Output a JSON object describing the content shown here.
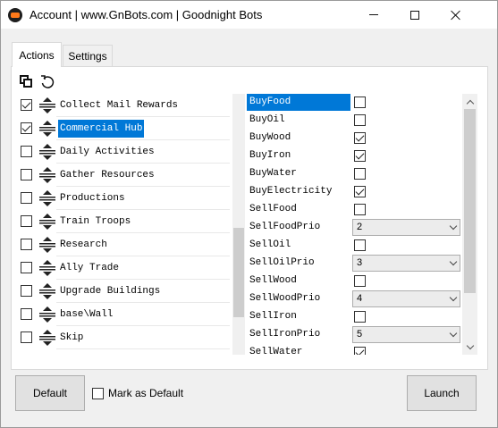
{
  "window": {
    "title": "Account | www.GnBots.com | Goodnight Bots",
    "icon": "gnbots-app-icon",
    "controls": [
      "minimize-icon",
      "maximize-icon",
      "close-icon"
    ]
  },
  "tabs": [
    {
      "label": "Actions",
      "active": true
    },
    {
      "label": "Settings",
      "active": false
    }
  ],
  "toolbar": {
    "icons": [
      "copy-icon",
      "reset-icon"
    ]
  },
  "actions": [
    {
      "label": "Collect Mail Rewards",
      "checked": true,
      "selected": false
    },
    {
      "label": "Commercial Hub",
      "checked": true,
      "selected": true
    },
    {
      "label": "Daily Activities",
      "checked": false,
      "selected": false
    },
    {
      "label": "Gather Resources",
      "checked": false,
      "selected": false
    },
    {
      "label": "Productions",
      "checked": false,
      "selected": false
    },
    {
      "label": "Train Troops",
      "checked": false,
      "selected": false
    },
    {
      "label": "Research",
      "checked": false,
      "selected": false
    },
    {
      "label": "Ally Trade",
      "checked": false,
      "selected": false
    },
    {
      "label": "Upgrade Buildings",
      "checked": false,
      "selected": false
    },
    {
      "label": "base\\Wall",
      "checked": false,
      "selected": false
    },
    {
      "label": "Skip",
      "checked": false,
      "selected": false
    }
  ],
  "settings": [
    {
      "label": "BuyFood",
      "type": "checkbox",
      "checked": false,
      "selected": true
    },
    {
      "label": "BuyOil",
      "type": "checkbox",
      "checked": false
    },
    {
      "label": "BuyWood",
      "type": "checkbox",
      "checked": true
    },
    {
      "label": "BuyIron",
      "type": "checkbox",
      "checked": true
    },
    {
      "label": "BuyWater",
      "type": "checkbox",
      "checked": false
    },
    {
      "label": "BuyElectricity",
      "type": "checkbox",
      "checked": true
    },
    {
      "label": "SellFood",
      "type": "checkbox",
      "checked": false
    },
    {
      "label": "SellFoodPrio",
      "type": "select",
      "value": "2"
    },
    {
      "label": "SellOil",
      "type": "checkbox",
      "checked": false
    },
    {
      "label": "SellOilPrio",
      "type": "select",
      "value": "3"
    },
    {
      "label": "SellWood",
      "type": "checkbox",
      "checked": false
    },
    {
      "label": "SellWoodPrio",
      "type": "select",
      "value": "4"
    },
    {
      "label": "SellIron",
      "type": "checkbox",
      "checked": false
    },
    {
      "label": "SellIronPrio",
      "type": "select",
      "value": "5"
    },
    {
      "label": "SellWater",
      "type": "checkbox",
      "checked": true
    }
  ],
  "footer": {
    "default_label": "Default",
    "mark_default_label": "Mark as Default",
    "mark_default_checked": false,
    "launch_label": "Launch"
  },
  "colors": {
    "selection": "#0078d7",
    "window_bg": "#f0f0f0",
    "panel_bg": "#ffffff",
    "accent_icon": "#ff7a1a"
  }
}
